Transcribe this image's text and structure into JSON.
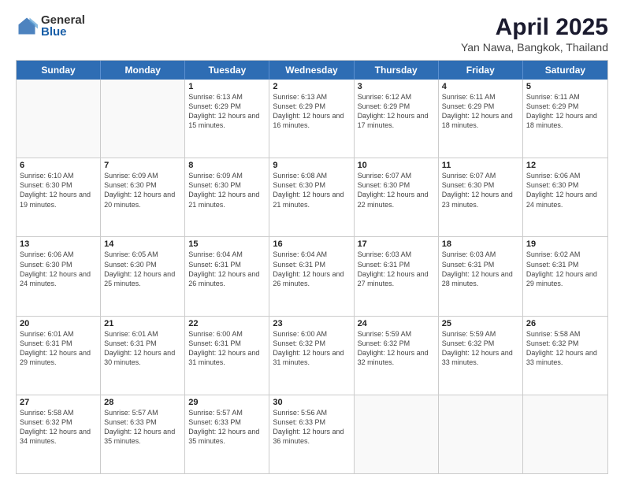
{
  "logo": {
    "general": "General",
    "blue": "Blue"
  },
  "header": {
    "title": "April 2025",
    "subtitle": "Yan Nawa, Bangkok, Thailand"
  },
  "weekdays": [
    "Sunday",
    "Monday",
    "Tuesday",
    "Wednesday",
    "Thursday",
    "Friday",
    "Saturday"
  ],
  "weeks": [
    [
      {
        "day": "",
        "info": ""
      },
      {
        "day": "",
        "info": ""
      },
      {
        "day": "1",
        "info": "Sunrise: 6:13 AM\nSunset: 6:29 PM\nDaylight: 12 hours and 15 minutes."
      },
      {
        "day": "2",
        "info": "Sunrise: 6:13 AM\nSunset: 6:29 PM\nDaylight: 12 hours and 16 minutes."
      },
      {
        "day": "3",
        "info": "Sunrise: 6:12 AM\nSunset: 6:29 PM\nDaylight: 12 hours and 17 minutes."
      },
      {
        "day": "4",
        "info": "Sunrise: 6:11 AM\nSunset: 6:29 PM\nDaylight: 12 hours and 18 minutes."
      },
      {
        "day": "5",
        "info": "Sunrise: 6:11 AM\nSunset: 6:29 PM\nDaylight: 12 hours and 18 minutes."
      }
    ],
    [
      {
        "day": "6",
        "info": "Sunrise: 6:10 AM\nSunset: 6:30 PM\nDaylight: 12 hours and 19 minutes."
      },
      {
        "day": "7",
        "info": "Sunrise: 6:09 AM\nSunset: 6:30 PM\nDaylight: 12 hours and 20 minutes."
      },
      {
        "day": "8",
        "info": "Sunrise: 6:09 AM\nSunset: 6:30 PM\nDaylight: 12 hours and 21 minutes."
      },
      {
        "day": "9",
        "info": "Sunrise: 6:08 AM\nSunset: 6:30 PM\nDaylight: 12 hours and 21 minutes."
      },
      {
        "day": "10",
        "info": "Sunrise: 6:07 AM\nSunset: 6:30 PM\nDaylight: 12 hours and 22 minutes."
      },
      {
        "day": "11",
        "info": "Sunrise: 6:07 AM\nSunset: 6:30 PM\nDaylight: 12 hours and 23 minutes."
      },
      {
        "day": "12",
        "info": "Sunrise: 6:06 AM\nSunset: 6:30 PM\nDaylight: 12 hours and 24 minutes."
      }
    ],
    [
      {
        "day": "13",
        "info": "Sunrise: 6:06 AM\nSunset: 6:30 PM\nDaylight: 12 hours and 24 minutes."
      },
      {
        "day": "14",
        "info": "Sunrise: 6:05 AM\nSunset: 6:30 PM\nDaylight: 12 hours and 25 minutes."
      },
      {
        "day": "15",
        "info": "Sunrise: 6:04 AM\nSunset: 6:31 PM\nDaylight: 12 hours and 26 minutes."
      },
      {
        "day": "16",
        "info": "Sunrise: 6:04 AM\nSunset: 6:31 PM\nDaylight: 12 hours and 26 minutes."
      },
      {
        "day": "17",
        "info": "Sunrise: 6:03 AM\nSunset: 6:31 PM\nDaylight: 12 hours and 27 minutes."
      },
      {
        "day": "18",
        "info": "Sunrise: 6:03 AM\nSunset: 6:31 PM\nDaylight: 12 hours and 28 minutes."
      },
      {
        "day": "19",
        "info": "Sunrise: 6:02 AM\nSunset: 6:31 PM\nDaylight: 12 hours and 29 minutes."
      }
    ],
    [
      {
        "day": "20",
        "info": "Sunrise: 6:01 AM\nSunset: 6:31 PM\nDaylight: 12 hours and 29 minutes."
      },
      {
        "day": "21",
        "info": "Sunrise: 6:01 AM\nSunset: 6:31 PM\nDaylight: 12 hours and 30 minutes."
      },
      {
        "day": "22",
        "info": "Sunrise: 6:00 AM\nSunset: 6:31 PM\nDaylight: 12 hours and 31 minutes."
      },
      {
        "day": "23",
        "info": "Sunrise: 6:00 AM\nSunset: 6:32 PM\nDaylight: 12 hours and 31 minutes."
      },
      {
        "day": "24",
        "info": "Sunrise: 5:59 AM\nSunset: 6:32 PM\nDaylight: 12 hours and 32 minutes."
      },
      {
        "day": "25",
        "info": "Sunrise: 5:59 AM\nSunset: 6:32 PM\nDaylight: 12 hours and 33 minutes."
      },
      {
        "day": "26",
        "info": "Sunrise: 5:58 AM\nSunset: 6:32 PM\nDaylight: 12 hours and 33 minutes."
      }
    ],
    [
      {
        "day": "27",
        "info": "Sunrise: 5:58 AM\nSunset: 6:32 PM\nDaylight: 12 hours and 34 minutes."
      },
      {
        "day": "28",
        "info": "Sunrise: 5:57 AM\nSunset: 6:33 PM\nDaylight: 12 hours and 35 minutes."
      },
      {
        "day": "29",
        "info": "Sunrise: 5:57 AM\nSunset: 6:33 PM\nDaylight: 12 hours and 35 minutes."
      },
      {
        "day": "30",
        "info": "Sunrise: 5:56 AM\nSunset: 6:33 PM\nDaylight: 12 hours and 36 minutes."
      },
      {
        "day": "",
        "info": ""
      },
      {
        "day": "",
        "info": ""
      },
      {
        "day": "",
        "info": ""
      }
    ]
  ]
}
